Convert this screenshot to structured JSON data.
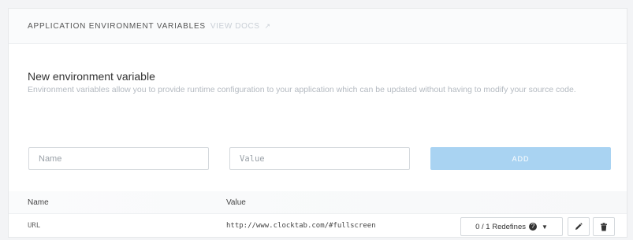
{
  "panel": {
    "title": "APPLICATION ENVIRONMENT VARIABLES",
    "link": "VIEW DOCS"
  },
  "section": {
    "title": "New environment variable",
    "description": "Environment variables allow you to provide runtime configuration to your application which can be updated without having to modify your source code."
  },
  "form": {
    "name_placeholder": "Name",
    "value_placeholder": "Value",
    "add_label": "ADD"
  },
  "table": {
    "headers": [
      "Name",
      "Value"
    ],
    "rows": [
      {
        "name": "URL",
        "value": "http://www.clocktab.com/#fullscreen",
        "redefines": "0 / 1 Redefines"
      }
    ]
  },
  "icons": {
    "external_link": "external-link-icon",
    "help": "question-circle-icon",
    "caret": "caret-down-icon",
    "edit": "pencil-icon",
    "delete": "trash-icon"
  },
  "colors": {
    "add_button": "#a9d3f2",
    "muted_text": "#b4bac1"
  }
}
